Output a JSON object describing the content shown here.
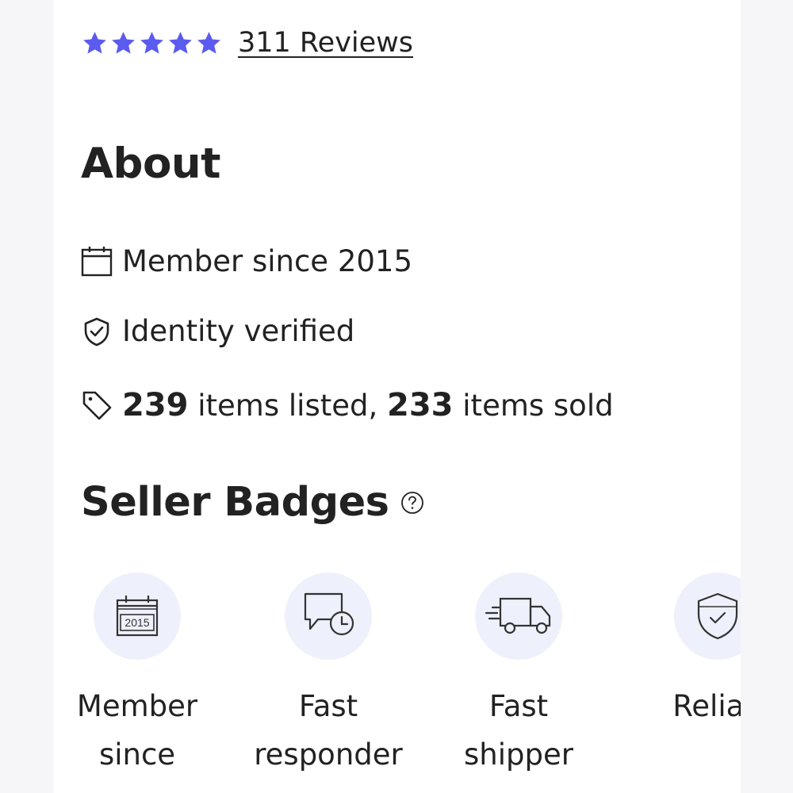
{
  "rating": {
    "stars": 5,
    "star_color": "#5b5bf0",
    "reviews_label": "311 Reviews"
  },
  "about": {
    "heading": "About",
    "member_since": "Member since 2015",
    "identity": "Identity verified",
    "items_listed_count": "239",
    "items_listed_text": " items listed, ",
    "items_sold_count": "233",
    "items_sold_text": " items sold"
  },
  "badges": {
    "heading": "Seller Badges",
    "items": [
      {
        "icon": "calendar-2015-icon",
        "icon_text": "2015",
        "label_line1": "Member",
        "label_line2": "since"
      },
      {
        "icon": "chat-clock-icon",
        "label_line1": "Fast",
        "label_line2": "responder"
      },
      {
        "icon": "truck-icon",
        "label_line1": "Fast",
        "label_line2": "shipper"
      },
      {
        "icon": "shield-check-icon",
        "label_line1": "Reliab",
        "label_line2": ""
      }
    ]
  },
  "colors": {
    "accent": "#5b5bf0",
    "badge_bg": "#eef0fb",
    "text": "#222222"
  }
}
